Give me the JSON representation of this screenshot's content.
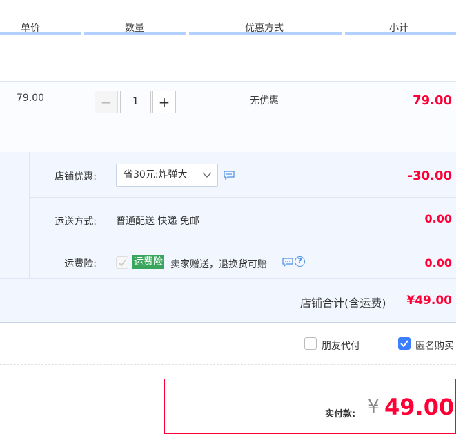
{
  "header": {
    "columns": [
      "单价",
      "数量",
      "优惠方式",
      "小计"
    ]
  },
  "item": {
    "unit_price": "79.00",
    "quantity": "1",
    "minus_label": "−",
    "plus_label": "+",
    "discount": "无优惠",
    "subtotal": "79.00"
  },
  "shop": {
    "promo_label": "店铺优惠:",
    "promo_selected": "省30元:炸弹大",
    "promo_amount": "-30.00",
    "shipping_label": "运送方式:",
    "shipping_value": "普通配送 快递 免邮",
    "shipping_amount": "0.00",
    "insurance_label": "运费险:",
    "insurance_badge": "运费险",
    "insurance_text": "卖家赠送，退换货可赔",
    "insurance_amount": "0.00",
    "total_label": "店铺合计(含运费)",
    "total_amount": "¥49.00"
  },
  "options": {
    "friend_pay": "朋友代付",
    "anonymous": "匿名购买"
  },
  "payment": {
    "label": "实付款:",
    "currency": "¥",
    "amount": "49.00"
  },
  "colors": {
    "accent_red": "#ff0036",
    "accent_blue": "#4a90e2",
    "badge_green": "#3aa55c"
  }
}
